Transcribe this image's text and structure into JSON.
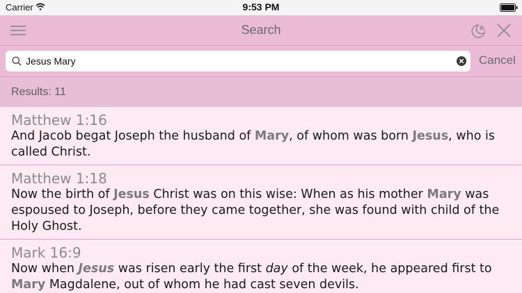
{
  "status_bar": {
    "carrier": "Carrier",
    "time": "9:53 PM"
  },
  "nav": {
    "title": "Search",
    "menu_icon": "hamburger-menu-icon",
    "night_icon": "night-mode-icon",
    "close_icon": "close-icon"
  },
  "search": {
    "value": "Jesus Mary",
    "placeholder": "",
    "cancel_label": "Cancel"
  },
  "results": {
    "label": "Results: 11"
  },
  "verses": [
    {
      "reference": "Matthew 1:16",
      "segments": [
        {
          "text": "And Jacob begat Joseph the husband of "
        },
        {
          "text": "Mary",
          "hl": true
        },
        {
          "text": ", of whom was born "
        },
        {
          "text": "Jesus",
          "hl": true
        },
        {
          "text": ", who is called Christ."
        }
      ]
    },
    {
      "reference": "Matthew 1:18",
      "segments": [
        {
          "text": "Now the birth of "
        },
        {
          "text": "Jesus",
          "hl": true
        },
        {
          "text": " Christ was on this wise: When as his mother "
        },
        {
          "text": "Mary",
          "hl": true
        },
        {
          "text": " was espoused to Joseph, before they came together, she was found with child of the Holy Ghost."
        }
      ]
    },
    {
      "reference": "Mark 16:9",
      "segments": [
        {
          "text": "Now when "
        },
        {
          "text": "Jesus",
          "hl": true,
          "it": true
        },
        {
          "text": " was risen early the first "
        },
        {
          "text": "day",
          "it": true
        },
        {
          "text": " of the week, he appeared first to "
        },
        {
          "text": "Mary",
          "hl": true
        },
        {
          "text": " Magdalene, out of whom he had cast seven devils."
        }
      ]
    }
  ]
}
